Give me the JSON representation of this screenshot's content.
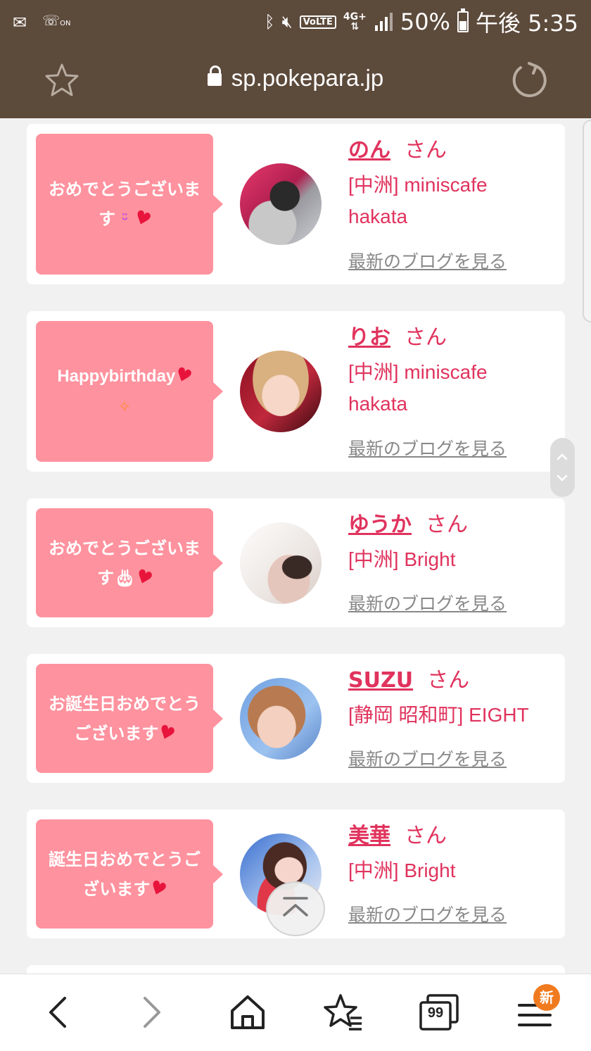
{
  "status_bar": {
    "battery": "50%",
    "time": "午後 5:35",
    "network": "4G+",
    "volte": "VoLTE",
    "wifi_call": "ON",
    "battery_level": 0.5,
    "icons": [
      "mail-icon",
      "wifi-call-icon",
      "bluetooth-icon",
      "mute-icon",
      "signal-icon",
      "battery-icon"
    ]
  },
  "browser": {
    "url": "sp.pokepara.jp",
    "secure": true
  },
  "cards": [
    {
      "message": "おめでとうございます",
      "emoji": [
        "smile",
        "heart"
      ],
      "name": "のん",
      "suffix": "さん",
      "shop": "[中洲] miniscafe hakata",
      "blog_link": "最新のブログを見る"
    },
    {
      "message": "Happybirthday",
      "emoji": [
        "heart",
        "sparkle"
      ],
      "name": "りお",
      "suffix": "さん",
      "shop": "[中洲] miniscafe hakata",
      "blog_link": "最新のブログを見る"
    },
    {
      "message": "おめでとうございます",
      "emoji": [
        "cake",
        "heart"
      ],
      "name": "ゆうか",
      "suffix": "さん",
      "shop": "[中洲] Bright",
      "blog_link": "最新のブログを見る"
    },
    {
      "message": "お誕生日おめでとうございます",
      "emoji": [
        "heart"
      ],
      "name": "SUZU",
      "suffix": "さん",
      "shop": "[静岡 昭和町] EIGHT",
      "blog_link": "最新のブログを見る"
    },
    {
      "message": "誕生日おめでとうございます",
      "emoji": [
        "heart"
      ],
      "name": "美華",
      "suffix": "さん",
      "shop": "[中洲] Bright",
      "blog_link": "最新のブログを見る"
    }
  ],
  "bottom_nav": {
    "tabs_count": "99",
    "menu_badge": "新"
  },
  "colors": {
    "toolbar": "#5c4a3b",
    "bubble": "#fe929e",
    "accent": "#e0335d",
    "link_gray": "#888888"
  }
}
